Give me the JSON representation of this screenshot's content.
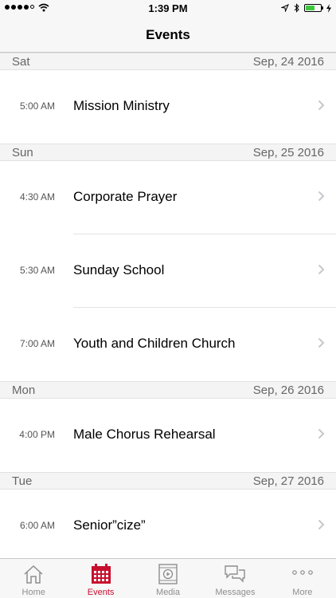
{
  "status_bar": {
    "time": "1:39 PM",
    "signal_icon": "signal-dots-icon",
    "wifi_icon": "wifi-icon",
    "location_icon": "location-arrow-icon",
    "bluetooth_icon": "bluetooth-icon",
    "battery_icon": "battery-icon",
    "battery_level": 0.6,
    "charging_icon": "charging-bolt-icon"
  },
  "nav": {
    "title": "Events"
  },
  "sections": [
    {
      "day": "Sat",
      "date": "Sep, 24 2016",
      "events": [
        {
          "time": "5:00 AM",
          "name": "Mission Ministry"
        }
      ]
    },
    {
      "day": "Sun",
      "date": "Sep, 25 2016",
      "events": [
        {
          "time": "4:30 AM",
          "name": "Corporate Prayer"
        },
        {
          "time": "5:30 AM",
          "name": "Sunday School"
        },
        {
          "time": "7:00 AM",
          "name": "Youth and Children Church"
        }
      ]
    },
    {
      "day": "Mon",
      "date": "Sep, 26 2016",
      "events": [
        {
          "time": "4:00 PM",
          "name": "Male Chorus Rehearsal"
        }
      ]
    },
    {
      "day": "Tue",
      "date": "Sep, 27 2016",
      "events": [
        {
          "time": "6:00 AM",
          "name": "Senior”cize”"
        }
      ]
    }
  ],
  "tabs": [
    {
      "label": "Home",
      "icon": "home-icon",
      "active": false
    },
    {
      "label": "Events",
      "icon": "calendar-icon",
      "active": true
    },
    {
      "label": "Media",
      "icon": "media-play-icon",
      "active": false
    },
    {
      "label": "Messages",
      "icon": "chat-bubbles-icon",
      "active": false
    },
    {
      "label": "More",
      "icon": "more-dots-icon",
      "active": false
    }
  ],
  "colors": {
    "accent": "#c8102e",
    "tab_inactive": "#8e8e8e",
    "battery": "#3cc83c"
  }
}
